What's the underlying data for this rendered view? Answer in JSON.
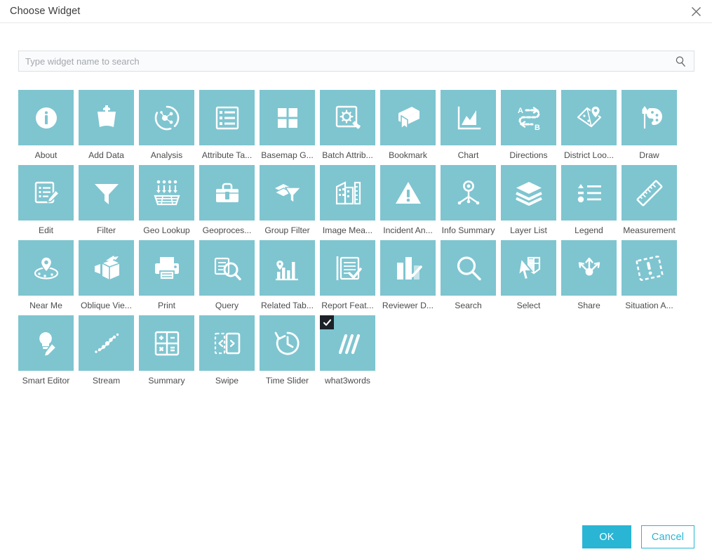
{
  "dialog": {
    "title": "Choose Widget",
    "close_icon": "close-icon"
  },
  "search": {
    "value": "",
    "placeholder": "Type widget name to search",
    "icon": "search-icon"
  },
  "widgets": [
    {
      "label": "About",
      "icon": "about-icon",
      "selected": false
    },
    {
      "label": "Add Data",
      "icon": "add-data-icon",
      "selected": false
    },
    {
      "label": "Analysis",
      "icon": "analysis-icon",
      "selected": false
    },
    {
      "label": "Attribute Ta...",
      "icon": "attribute-table-icon",
      "selected": false
    },
    {
      "label": "Basemap G...",
      "icon": "basemap-gallery-icon",
      "selected": false
    },
    {
      "label": "Batch Attrib...",
      "icon": "batch-attribute-icon",
      "selected": false
    },
    {
      "label": "Bookmark",
      "icon": "bookmark-icon",
      "selected": false
    },
    {
      "label": "Chart",
      "icon": "chart-icon",
      "selected": false
    },
    {
      "label": "Directions",
      "icon": "directions-icon",
      "selected": false
    },
    {
      "label": "District Loo...",
      "icon": "district-lookup-icon",
      "selected": false
    },
    {
      "label": "Draw",
      "icon": "draw-icon",
      "selected": false
    },
    {
      "label": "Edit",
      "icon": "edit-icon",
      "selected": false
    },
    {
      "label": "Filter",
      "icon": "filter-icon",
      "selected": false
    },
    {
      "label": "Geo Lookup",
      "icon": "geo-lookup-icon",
      "selected": false
    },
    {
      "label": "Geoproces...",
      "icon": "geoprocessing-icon",
      "selected": false
    },
    {
      "label": "Group Filter",
      "icon": "group-filter-icon",
      "selected": false
    },
    {
      "label": "Image Mea...",
      "icon": "image-measurement-icon",
      "selected": false
    },
    {
      "label": "Incident An...",
      "icon": "incident-analysis-icon",
      "selected": false
    },
    {
      "label": "Info Summary",
      "icon": "info-summary-icon",
      "selected": false
    },
    {
      "label": "Layer List",
      "icon": "layer-list-icon",
      "selected": false
    },
    {
      "label": "Legend",
      "icon": "legend-icon",
      "selected": false
    },
    {
      "label": "Measurement",
      "icon": "measurement-icon",
      "selected": false
    },
    {
      "label": "Near Me",
      "icon": "near-me-icon",
      "selected": false
    },
    {
      "label": "Oblique Vie...",
      "icon": "oblique-viewer-icon",
      "selected": false
    },
    {
      "label": "Print",
      "icon": "print-icon",
      "selected": false
    },
    {
      "label": "Query",
      "icon": "query-icon",
      "selected": false
    },
    {
      "label": "Related Tab...",
      "icon": "related-table-icon",
      "selected": false
    },
    {
      "label": "Report Feat...",
      "icon": "report-feature-icon",
      "selected": false
    },
    {
      "label": "Reviewer D...",
      "icon": "reviewer-dashboard-icon",
      "selected": false
    },
    {
      "label": "Search",
      "icon": "search-widget-icon",
      "selected": false
    },
    {
      "label": "Select",
      "icon": "select-icon",
      "selected": false
    },
    {
      "label": "Share",
      "icon": "share-icon",
      "selected": false
    },
    {
      "label": "Situation A...",
      "icon": "situation-awareness-icon",
      "selected": false
    },
    {
      "label": "Smart Editor",
      "icon": "smart-editor-icon",
      "selected": false
    },
    {
      "label": "Stream",
      "icon": "stream-icon",
      "selected": false
    },
    {
      "label": "Summary",
      "icon": "summary-icon",
      "selected": false
    },
    {
      "label": "Swipe",
      "icon": "swipe-icon",
      "selected": false
    },
    {
      "label": "Time Slider",
      "icon": "time-slider-icon",
      "selected": false
    },
    {
      "label": "what3words",
      "icon": "what3words-icon",
      "selected": true
    }
  ],
  "footer": {
    "ok_label": "OK",
    "cancel_label": "Cancel"
  },
  "colors": {
    "tile": "#7ec5d0",
    "accent": "#2ab5d4",
    "checkbox": "#1c2228"
  }
}
